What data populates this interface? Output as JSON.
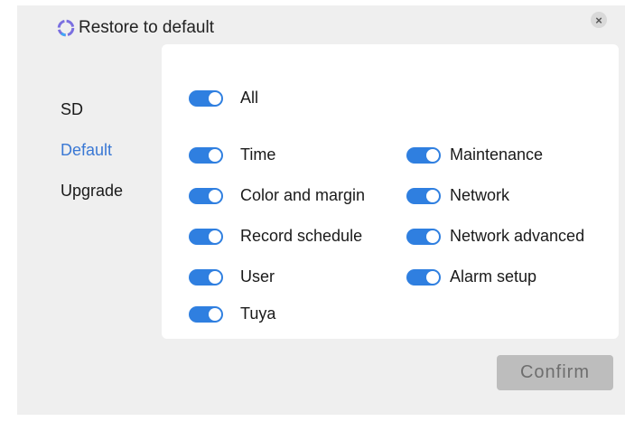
{
  "dialog": {
    "title": "Restore to default",
    "close_symbol": "×",
    "confirm_label": "Confirm",
    "colors": {
      "accent": "#2f7fe0",
      "nav_active": "#3a78d4",
      "background": "#efefef",
      "panel": "#ffffff",
      "confirm_bg": "#bdbdbd"
    },
    "icons": {
      "title": "refresh-icon",
      "close": "close-icon"
    }
  },
  "nav": {
    "items": [
      {
        "label": "SD",
        "active": false
      },
      {
        "label": "Default",
        "active": true
      },
      {
        "label": "Upgrade",
        "active": false
      }
    ]
  },
  "options": {
    "all": {
      "label": "All",
      "enabled": true
    },
    "left": [
      {
        "label": "Time",
        "enabled": true
      },
      {
        "label": "Color and margin",
        "enabled": true
      },
      {
        "label": "Record schedule",
        "enabled": true
      },
      {
        "label": "User",
        "enabled": true
      },
      {
        "label": "Tuya",
        "enabled": true
      }
    ],
    "right": [
      {
        "label": "Maintenance",
        "enabled": true
      },
      {
        "label": "Network",
        "enabled": true
      },
      {
        "label": "Network advanced",
        "enabled": true
      },
      {
        "label": "Alarm setup",
        "enabled": true
      }
    ]
  }
}
